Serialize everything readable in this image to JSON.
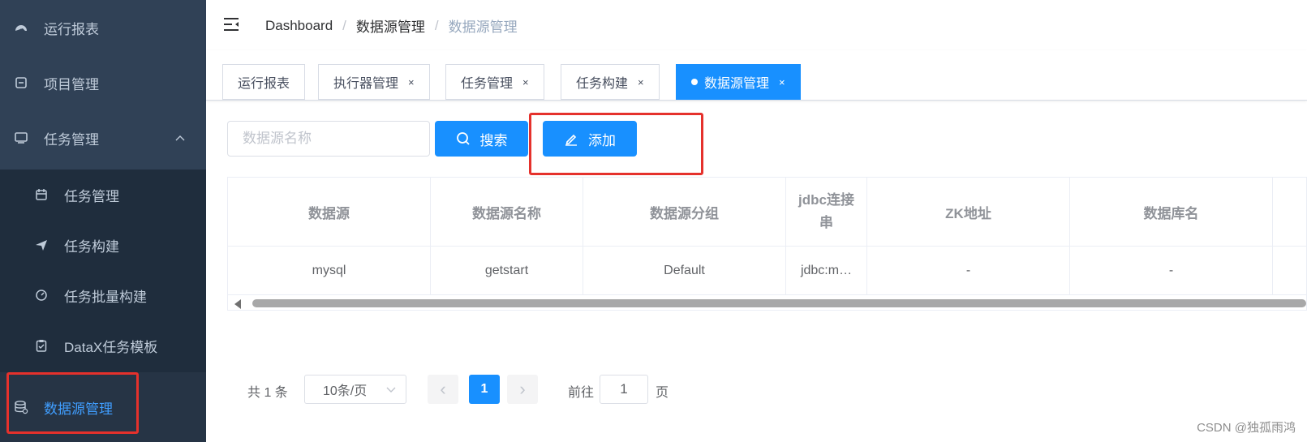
{
  "sidebar": {
    "items": [
      {
        "label": "运行报表",
        "icon": "dashboard-icon"
      },
      {
        "label": "项目管理",
        "icon": "project-icon"
      },
      {
        "label": "任务管理",
        "icon": "monitor-icon",
        "expanded": true
      }
    ],
    "subitems": [
      {
        "label": "任务管理",
        "icon": "calendar-icon"
      },
      {
        "label": "任务构建",
        "icon": "paper-plane-icon"
      },
      {
        "label": "任务批量构建",
        "icon": "gauge-icon"
      },
      {
        "label": "DataX任务模板",
        "icon": "clipboard-icon"
      }
    ],
    "active_item": {
      "label": "数据源管理",
      "icon": "database-icon"
    }
  },
  "breadcrumb": [
    "Dashboard",
    "数据源管理",
    "数据源管理"
  ],
  "tags": [
    {
      "label": "运行报表",
      "closable": false
    },
    {
      "label": "执行器管理",
      "closable": true,
      "close": "×"
    },
    {
      "label": "任务管理",
      "closable": true,
      "close": "×"
    },
    {
      "label": "任务构建",
      "closable": true,
      "close": "×"
    },
    {
      "label": "数据源管理",
      "closable": true,
      "close": "×",
      "active": true
    }
  ],
  "filter": {
    "placeholder": "数据源名称",
    "search_label": "搜索",
    "add_label": "添加"
  },
  "table": {
    "columns": [
      "数据源",
      "数据源名称",
      "数据源分组",
      "jdbc连接串",
      "ZK地址",
      "数据库名"
    ],
    "rows": [
      [
        "mysql",
        "getstart",
        "Default",
        "jdbc:m…",
        "-",
        "-"
      ]
    ]
  },
  "pagination": {
    "total_text": "共 1 条",
    "page_size": "10条/页",
    "current_page": "1",
    "prev": "‹",
    "next": "›",
    "jump_prefix": "前往",
    "jump_value": "1",
    "jump_suffix": "页"
  },
  "watermark": "CSDN @独孤雨鸿",
  "colors": {
    "sidebar_bg": "#304156",
    "submenu_bg": "#1f2d3d",
    "primary": "#1890ff",
    "active_text": "#409eff",
    "highlight": "#e5312c"
  }
}
